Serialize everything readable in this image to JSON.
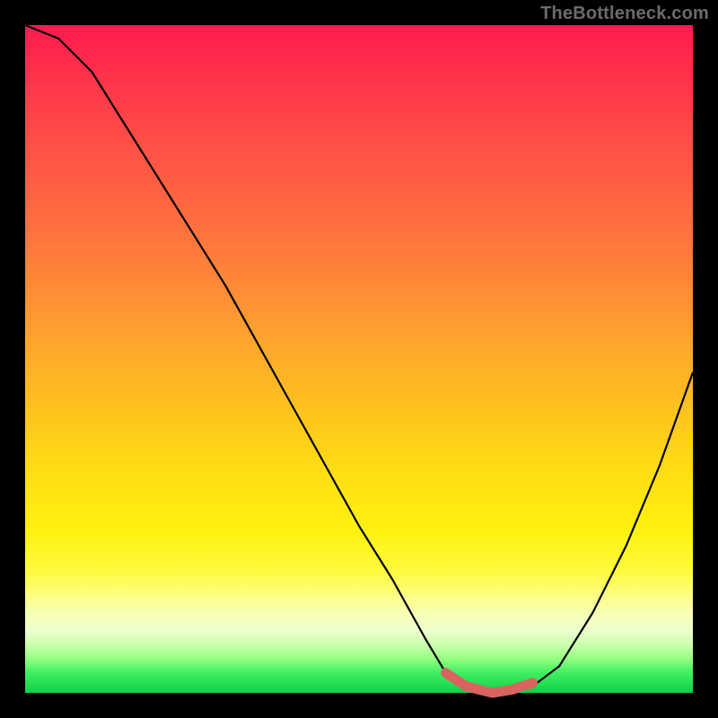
{
  "attribution": "TheBottleneck.com",
  "colors": {
    "background": "#000000",
    "curve_stroke": "#000000",
    "band_stroke": "#d9645f"
  },
  "chart_data": {
    "type": "line",
    "title": "",
    "xlabel": "",
    "ylabel": "",
    "xlim": [
      0,
      100
    ],
    "ylim": [
      0,
      100
    ],
    "series": [
      {
        "name": "bottleneck-curve",
        "x": [
          0,
          5,
          10,
          15,
          20,
          25,
          30,
          35,
          40,
          45,
          50,
          55,
          60,
          63,
          66,
          70,
          73,
          76,
          80,
          85,
          90,
          95,
          100
        ],
        "y": [
          100,
          98,
          93,
          85,
          77,
          69,
          61,
          52,
          43,
          34,
          25,
          17,
          8,
          3,
          1,
          0,
          0,
          1,
          4,
          12,
          22,
          34,
          48
        ]
      }
    ],
    "annotations": [
      {
        "name": "optimal-band",
        "x": [
          63,
          66,
          70,
          73,
          76
        ],
        "y": [
          3,
          1,
          0,
          0.5,
          1.5
        ]
      }
    ]
  }
}
